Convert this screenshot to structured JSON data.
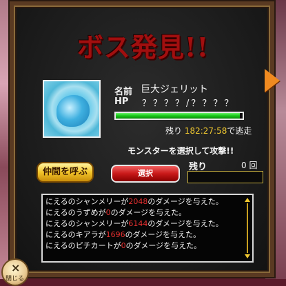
{
  "title": "ボス発見!!",
  "boss": {
    "name_label": "名前",
    "name": "巨大ジェリット",
    "hp_label": "HP",
    "hp_value": "？？？？/？？？？",
    "hp_fraction": 0.98,
    "time_prefix": "残り",
    "time_remaining": "182:27:58",
    "time_suffix": "で逃走"
  },
  "select_message": "モンスターを選択して攻撃!!",
  "buttons": {
    "call_friends": "仲間を呼ぶ",
    "select": "選択"
  },
  "remaining": {
    "label": "残り",
    "count": "0 回"
  },
  "log": [
    {
      "pre": "にえるのシャンメリーが",
      "dmg": "2048",
      "post": "のダメージを与えた。"
    },
    {
      "pre": "にえるのうずめが",
      "dmg": "0",
      "post": "のダメージを与えた。"
    },
    {
      "pre": "にえるのシャンメリーが",
      "dmg": "6144",
      "post": "のダメージを与えた。"
    },
    {
      "pre": "にえるのキアラが",
      "dmg": "1696",
      "post": "のダメージを与えた。"
    },
    {
      "pre": "にえるのピチカートが",
      "dmg": "0",
      "post": "のダメージを与えた。"
    }
  ],
  "close": {
    "icon": "close-icon",
    "label": "閉じる"
  },
  "colors": {
    "title": "#a10f0f",
    "hp_bar": "#18c818",
    "damage": "#e83030",
    "timer": "#f0c830"
  }
}
